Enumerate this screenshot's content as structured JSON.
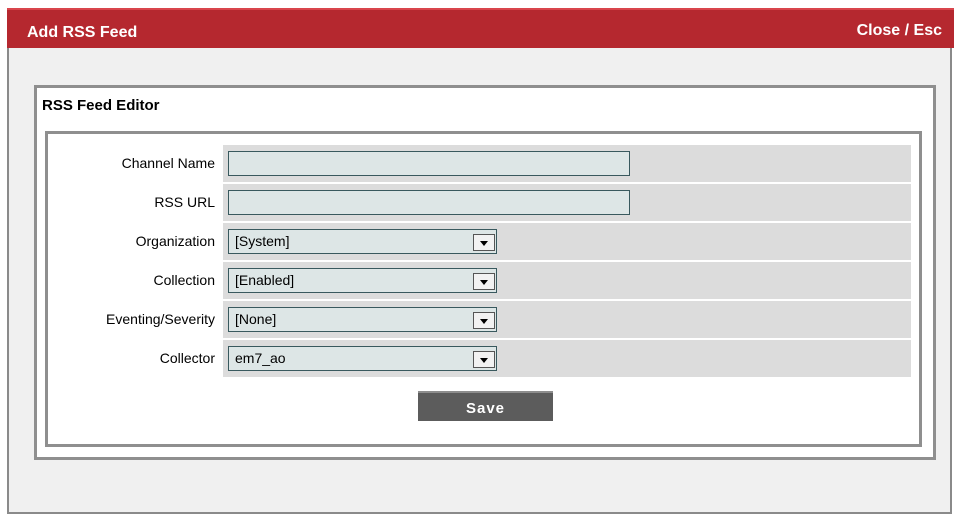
{
  "window": {
    "title": "Add RSS Feed",
    "close_label": "Close / Esc"
  },
  "editor": {
    "title": "RSS Feed Editor",
    "fields": [
      {
        "label": "Channel Name",
        "type": "text",
        "value": ""
      },
      {
        "label": "RSS URL",
        "type": "text",
        "value": ""
      },
      {
        "label": "Organization",
        "type": "select",
        "value": "[System]"
      },
      {
        "label": "Collection",
        "type": "select",
        "value": "[Enabled]"
      },
      {
        "label": "Eventing/Severity",
        "type": "select",
        "value": "[None]"
      },
      {
        "label": "Collector",
        "type": "select",
        "value": "em7_ao"
      }
    ],
    "save_label": "Save"
  },
  "colors": {
    "titlebar": "#b5282f",
    "field_bg": "#dde6e6",
    "row_bg": "#dcdcdc",
    "save_bg": "#5c5c5c"
  }
}
